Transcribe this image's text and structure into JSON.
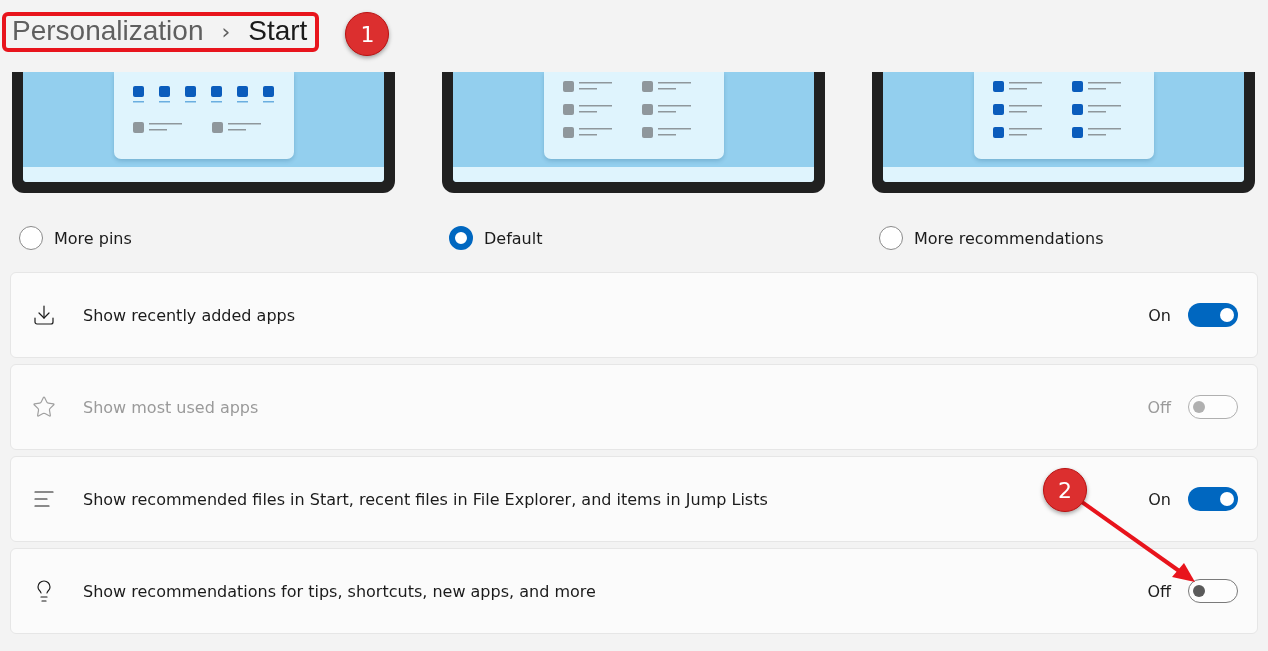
{
  "breadcrumb": {
    "parent": "Personalization",
    "separator": "›",
    "current": "Start",
    "highlighted": true
  },
  "layout_options": [
    {
      "kind": "pins",
      "label": "More pins",
      "selected": false
    },
    {
      "kind": "default",
      "label": "Default",
      "selected": true
    },
    {
      "kind": "recommendations",
      "label": "More recommendations",
      "selected": false
    }
  ],
  "settings": [
    {
      "label": "Show recently added apps",
      "state_text": "On",
      "on": true,
      "disabled": false
    },
    {
      "label": "Show most used apps",
      "state_text": "Off",
      "on": false,
      "disabled": true
    },
    {
      "label": "Show recommended files in Start, recent files in File Explorer, and items in Jump Lists",
      "state_text": "On",
      "on": true,
      "disabled": false
    },
    {
      "label": "Show recommendations for tips, shortcuts, new apps, and more",
      "state_text": "Off",
      "on": false,
      "disabled": false
    }
  ],
  "annotations": [
    {
      "label": "1"
    },
    {
      "label": "2"
    }
  ]
}
